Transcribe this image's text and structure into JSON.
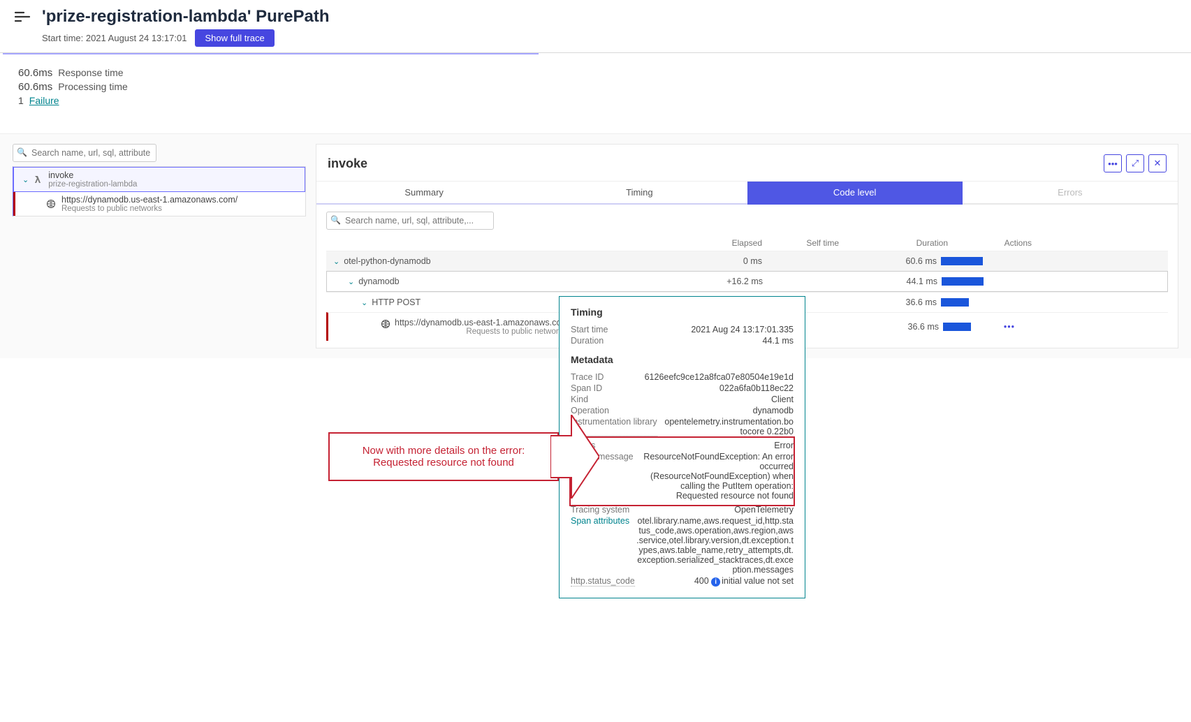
{
  "header": {
    "title": "'prize-registration-lambda' PurePath",
    "start_label": "Start time: 2021 August 24 13:17:01",
    "full_trace_btn": "Show full trace"
  },
  "metrics": {
    "response_time_val": "60.6ms",
    "response_time_lbl": "Response time",
    "processing_time_val": "60.6ms",
    "processing_time_lbl": "Processing time",
    "failure_count": "1",
    "failure_lbl": "Failure"
  },
  "search": {
    "placeholder": "Search name, url, sql, attribute,..."
  },
  "tree": {
    "root_name": "invoke",
    "root_sub": "prize-registration-lambda",
    "child_name": "https://dynamodb.us-east-1.amazonaws.com/",
    "child_sub": "Requests to public networks"
  },
  "detail": {
    "title": "invoke",
    "tabs": {
      "summary": "Summary",
      "timing": "Timing",
      "code": "Code level",
      "errors": "Errors"
    },
    "cols": {
      "elapsed": "Elapsed",
      "self": "Self time",
      "duration": "Duration",
      "actions": "Actions"
    },
    "rows": [
      {
        "name": "otel-python-dynamodb",
        "elapsed": "0 ms",
        "self": "",
        "dur": "60.6 ms",
        "bar": 60,
        "indent": 0,
        "toggle": true
      },
      {
        "name": "dynamodb",
        "elapsed": "+16.2 ms",
        "self": "",
        "dur": "44.1 ms",
        "bar": 60,
        "indent": 20,
        "toggle": true
      },
      {
        "name": "HTTP POST",
        "elapsed": "",
        "self": "",
        "dur": "36.6 ms",
        "bar": 40,
        "indent": 40,
        "toggle": true
      },
      {
        "name": "https://dynamodb.us-east-1.amazonaws.com/",
        "sub": "Requests to public networks",
        "elapsed": "",
        "self": "",
        "dur": "36.6 ms",
        "bar": 40,
        "indent": 60,
        "globe": true,
        "actions": "•••"
      }
    ]
  },
  "popover": {
    "timing_h": "Timing",
    "start_k": "Start time",
    "start_v": "2021 Aug 24 13:17:01.335",
    "dur_k": "Duration",
    "dur_v": "44.1 ms",
    "meta_h": "Metadata",
    "trace_k": "Trace ID",
    "trace_v": "6126eefc9ce12a8fca07e80504e19e1d",
    "span_k": "Span ID",
    "span_v": "022a6fa0b118ec22",
    "kind_k": "Kind",
    "kind_v": "Client",
    "op_k": "Operation",
    "op_v": "dynamodb",
    "lib_k": "Instrumentation library",
    "lib_v": "opentelemetry.instrumentation.botocore 0.22b0",
    "status_k": "Status",
    "status_v": "Error",
    "status_msg_k": "Status message",
    "status_msg_v": "ResourceNotFoundException: An error occurred (ResourceNotFoundException) when calling the PutItem operation: Requested resource not found",
    "tracing_k": "Tracing system",
    "tracing_v": "OpenTelemetry",
    "attrs_k": "Span attributes",
    "attrs_v": "otel.library.name,aws.request_id,http.status_code,aws.operation,aws.region,aws.service,otel.library.version,dt.exception.types,aws.table_name,retry_attempts,dt.exception.serialized_stacktraces,dt.exception.messages",
    "http_k": "http.status_code",
    "http_v": "400",
    "http_note": "initial value not set"
  },
  "callout": {
    "text": "Now with more details on the error: Requested resource not found"
  }
}
